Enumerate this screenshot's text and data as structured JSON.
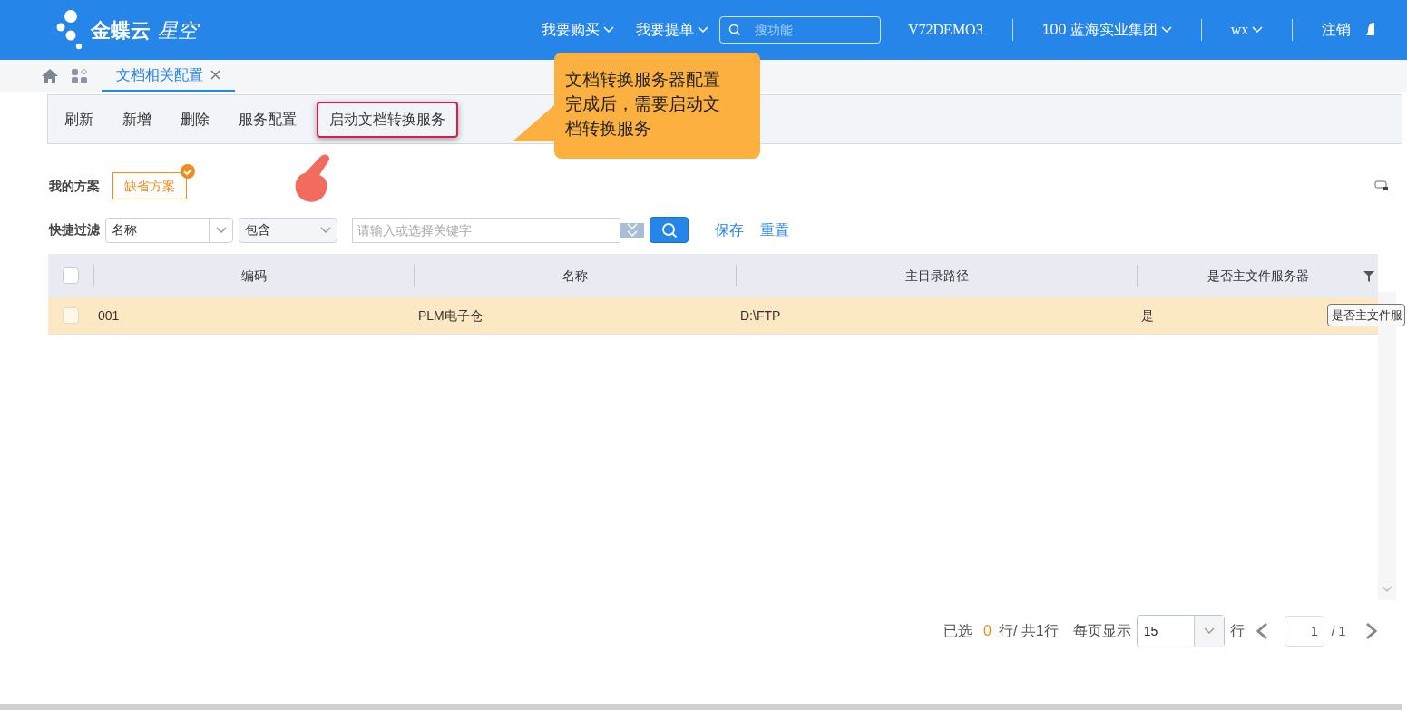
{
  "header": {
    "logo_main": "金蝶云",
    "logo_sub": "星空",
    "menus": [
      {
        "label": "我要购买"
      },
      {
        "label": "我要提单"
      }
    ],
    "search": {
      "placeholder": "搜功能"
    },
    "account": "V72DEMO3",
    "org": "100 蓝海实业集团",
    "user": "wx",
    "logout": "注销"
  },
  "tabs": [
    {
      "label": "文档相关配置",
      "selected": true
    }
  ],
  "toolbar": [
    {
      "label": "刷新",
      "highlighted": false
    },
    {
      "label": "新增",
      "highlighted": false
    },
    {
      "label": "删除",
      "highlighted": false
    },
    {
      "label": "服务配置",
      "highlighted": false
    },
    {
      "label": "启动文档转换服务",
      "highlighted": true
    }
  ],
  "callout": "文档转换服务器配置完成后，需要启动文档转换服务",
  "schemes": {
    "label": "我的方案",
    "items": [
      {
        "label": "缺省方案",
        "selected": true
      }
    ]
  },
  "filter": {
    "label": "快捷过滤",
    "field": "名称",
    "operator": "包含",
    "keyword_placeholder": "请输入或选择关键字",
    "save": "保存",
    "reset": "重置"
  },
  "table": {
    "header_checked": false,
    "columns": [
      "编码",
      "名称",
      "主目录路径",
      "是否主文件服务器"
    ],
    "rows": [
      {
        "cells": [
          "001",
          "PLM电子仓",
          "D:\\FTP",
          "是"
        ],
        "checked": false,
        "selected": true
      }
    ]
  },
  "tooltip": "是否主文件服",
  "pager": {
    "selected_prefix": "已选",
    "selected_count": "0",
    "selected_suffix": "行/ 共1行",
    "per_page_label": "每页显示",
    "per_page": "15",
    "rows_label": "行",
    "page": "1",
    "total_pages": "/ 1"
  }
}
